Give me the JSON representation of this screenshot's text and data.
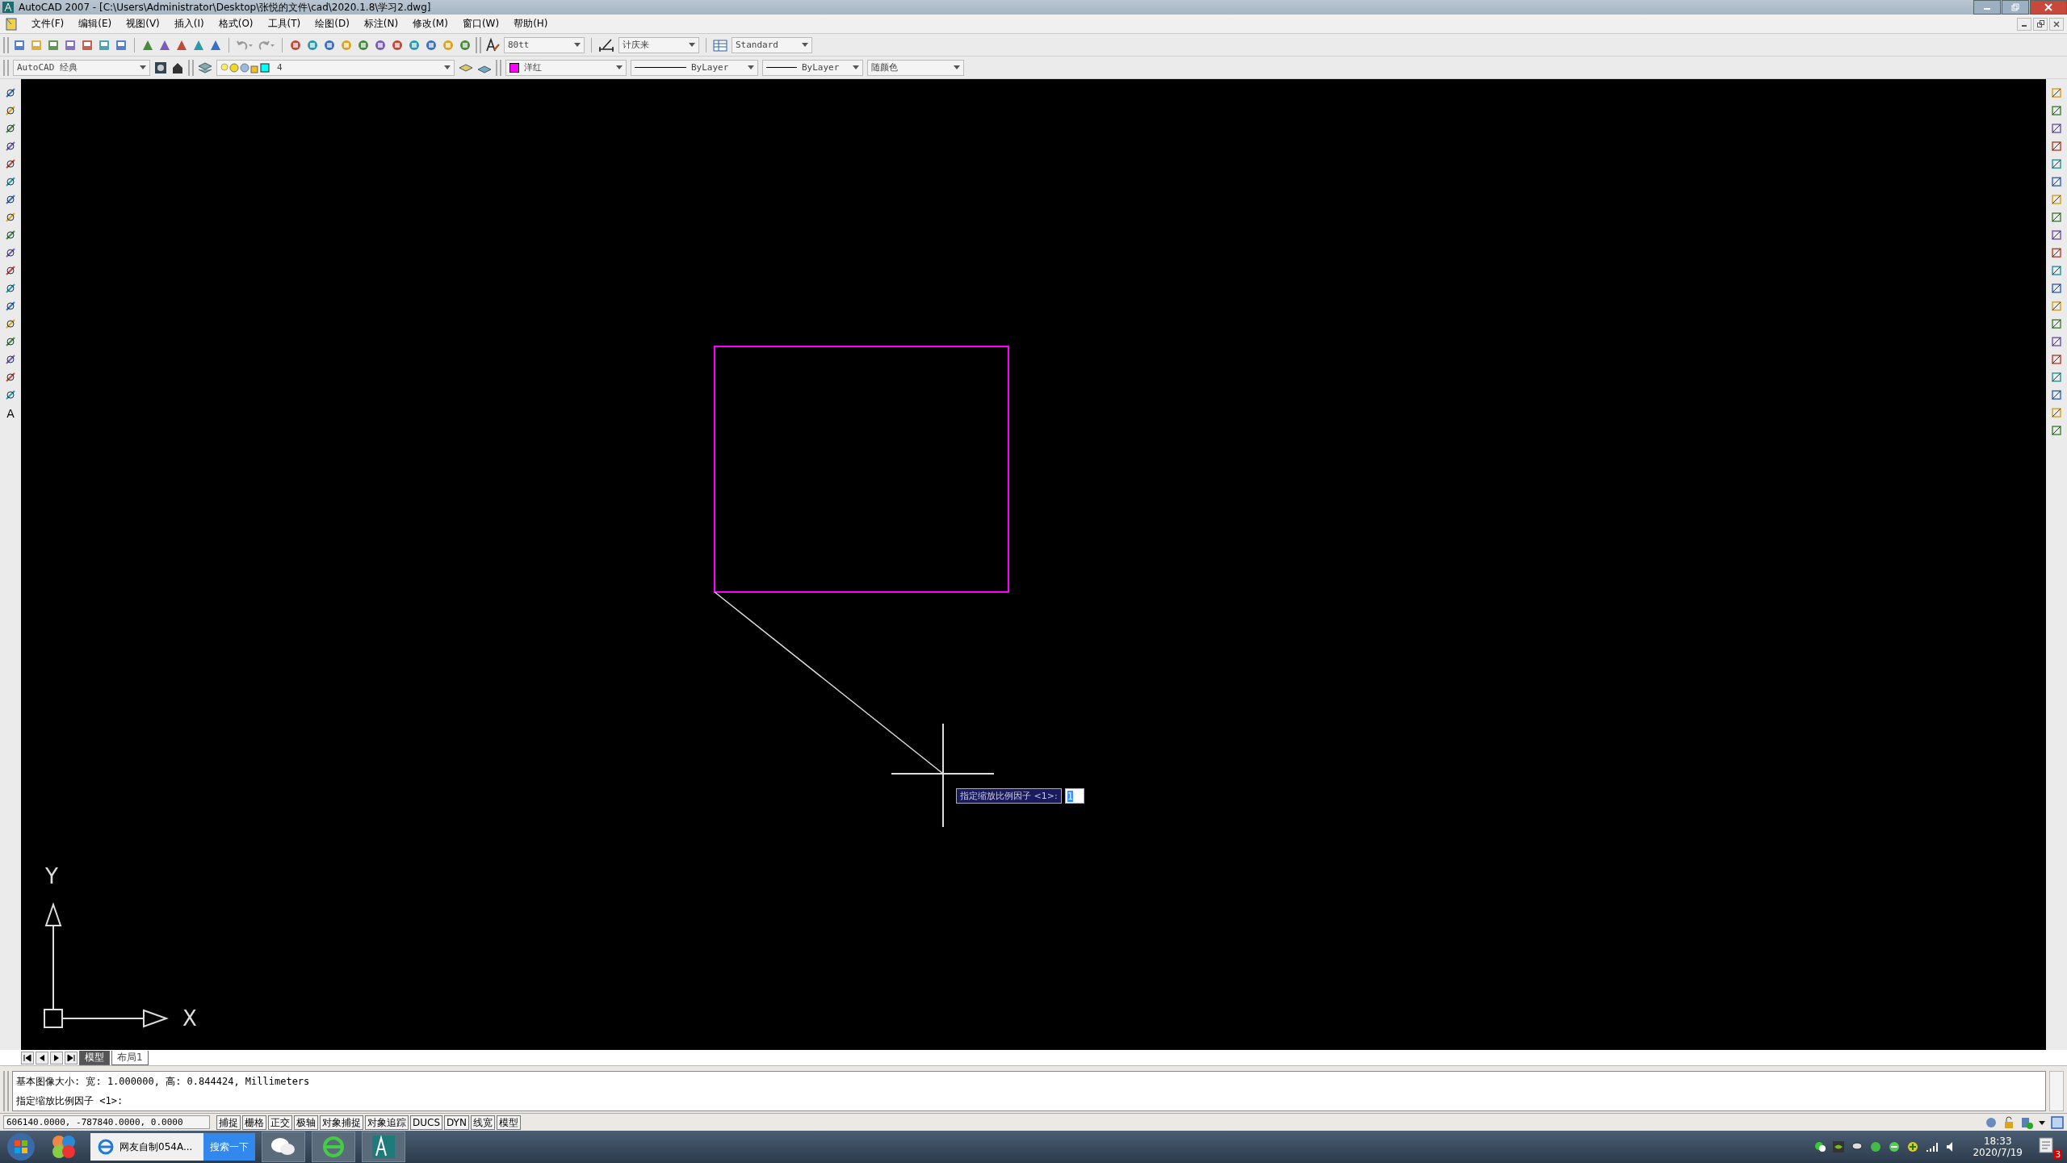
{
  "window": {
    "title": "AutoCAD 2007 - [C:\\Users\\Administrator\\Desktop\\张悦的文件\\cad\\2020.1.8\\学习2.dwg]"
  },
  "menu": [
    "文件(F)",
    "编辑(E)",
    "视图(V)",
    "插入(I)",
    "格式(O)",
    "工具(T)",
    "绘图(D)",
    "标注(N)",
    "修改(M)",
    "窗口(W)",
    "帮助(H)"
  ],
  "styles_toolbar": {
    "text_style": "80tt",
    "dimension_style": "计庆来",
    "table_style": "Standard"
  },
  "properties_toolbar": {
    "workspace": "AutoCAD 经典",
    "layer": "4",
    "color": {
      "label": "洋红",
      "color": "#ff00ff"
    },
    "linetype": "ByLayer",
    "lineweight": "ByLayer",
    "plot_style": "随颜色"
  },
  "draw_toolbar": {
    "text_tool": "A"
  },
  "canvas": {
    "dynamic_input": {
      "prompt": "指定缩放比例因子 <1>:",
      "value": "1"
    },
    "ucs": {
      "y_label": "Y",
      "x_label": "X"
    }
  },
  "layout_tabs": [
    {
      "label": "模型",
      "selected": true
    },
    {
      "label": "布局1",
      "selected": false
    }
  ],
  "command_lines": [
    "基本图像大小: 宽: 1.000000, 高: 0.844424, Millimeters",
    "指定缩放比例因子 <1>:"
  ],
  "status_bar": {
    "coordinates": "606140.0000, -787840.0000, 0.0000",
    "toggles": [
      "捕捉",
      "栅格",
      "正交",
      "极轴",
      "对象捕捉",
      "对象追踪",
      "DUCS",
      "DYN",
      "线宽",
      "模型"
    ]
  },
  "taskbar": {
    "browser_tab": "网友自制054A...",
    "search_button": "搜索一下",
    "time": "18:33",
    "date": "2020/7/19",
    "notification_count": "3"
  }
}
